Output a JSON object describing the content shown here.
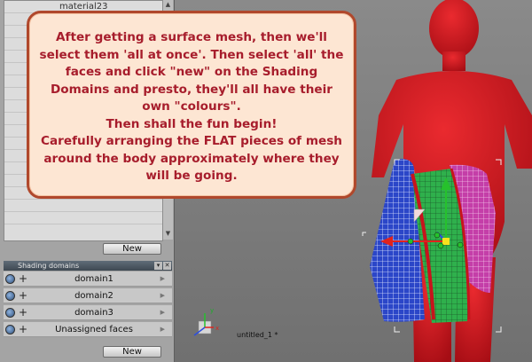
{
  "materials": {
    "top_item_label": "material23"
  },
  "buttons": {
    "new_material": "New",
    "new_domain": "New"
  },
  "shading_domains": {
    "title": "Shading domains",
    "items": [
      {
        "label": "domain1"
      },
      {
        "label": "domain2"
      },
      {
        "label": "domain3"
      },
      {
        "label": "Unassigned faces"
      }
    ]
  },
  "viewport": {
    "object_label": "untitled_1 *",
    "axis_y": "y",
    "axis_x": "x",
    "figure_color": "#d2131c",
    "mesh_colors": {
      "left_panel": "#2b46c8",
      "center_panel": "#2fb04c",
      "right_panel": "#c43ea8"
    }
  },
  "tutorial_callout": {
    "lines": [
      "After getting a surface mesh, then we'll",
      "select them 'all at once'. Then select 'all' the",
      "faces and click \"new\" on the Shading",
      "Domains and presto, they'll all have their",
      "own \"colours\".",
      "Then shall the fun begin!",
      "Carefully arranging the FLAT pieces of mesh",
      "around the body approximately where they",
      "will be going."
    ]
  }
}
